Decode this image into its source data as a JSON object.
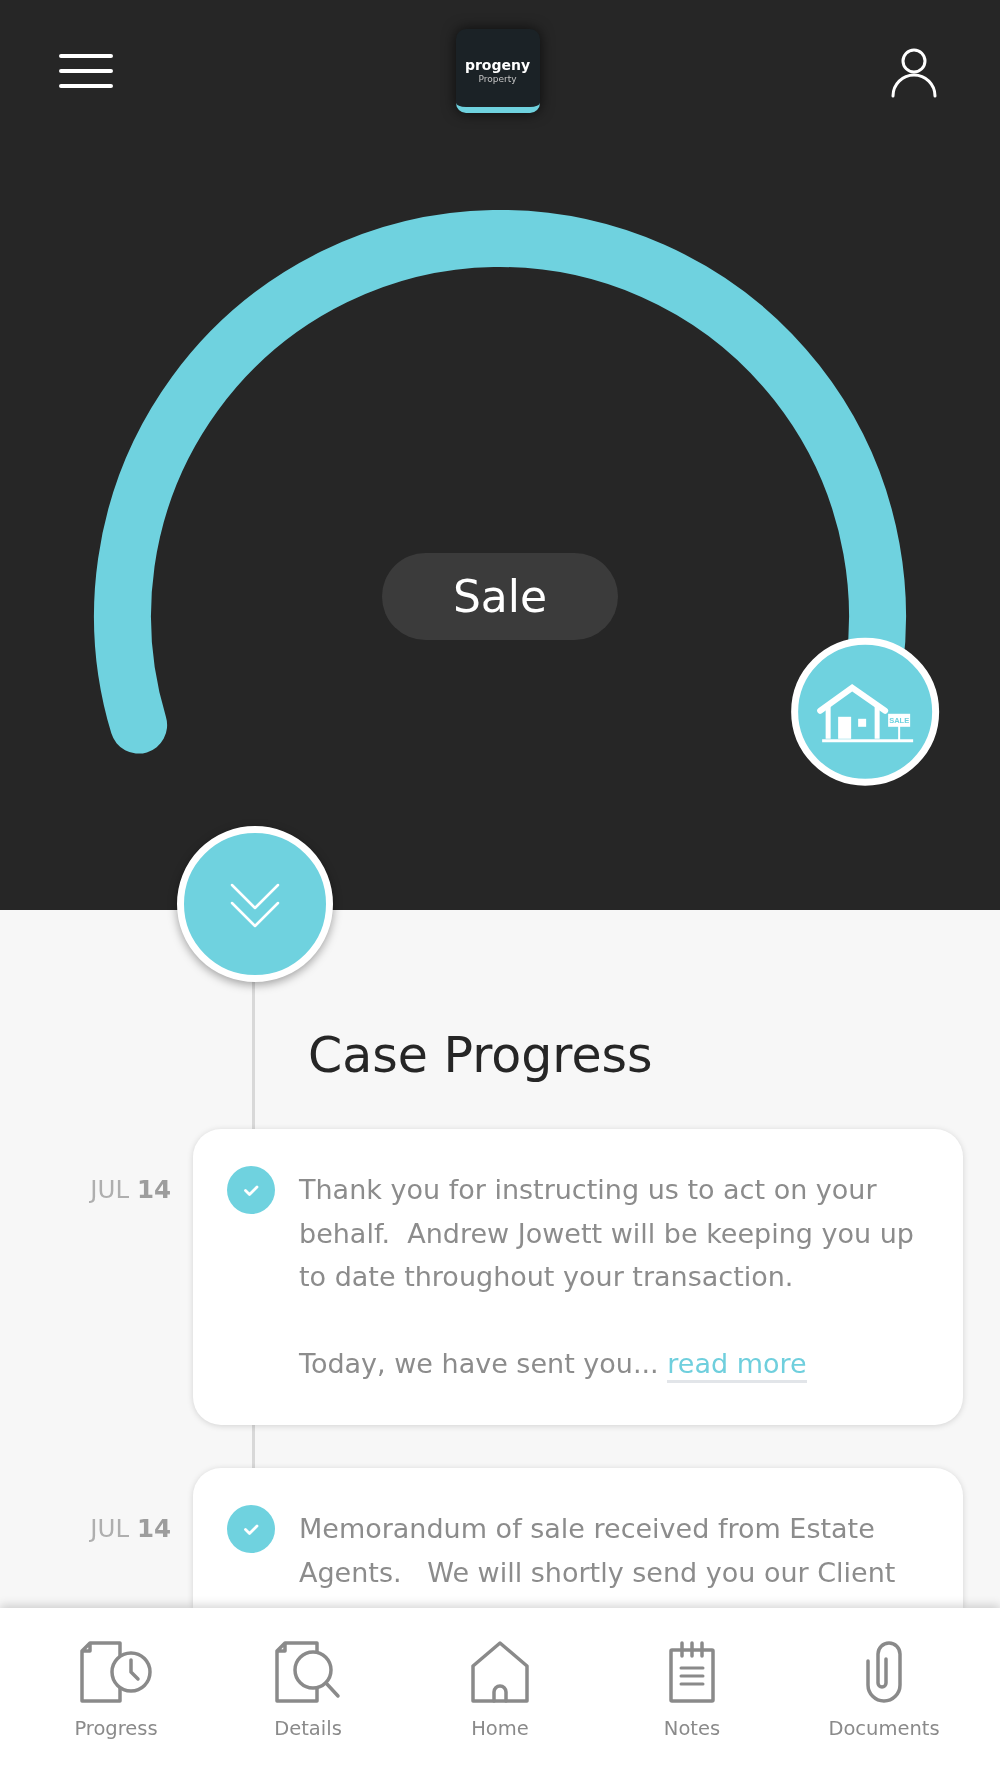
{
  "header": {
    "logo": {
      "name": "progeny",
      "tagline": "Property"
    }
  },
  "gauge": {
    "label": "Sale",
    "sign": "SALE"
  },
  "timeline": {
    "title": "Case Progress",
    "entries": [
      {
        "date": "JUL **14**",
        "done": true,
        "paragraphs": [
          "Thank you for instructing us to act on your behalf.  Andrew Jowett will be keeping you up to date throughout your transaction.",
          "Today, we have sent you..."
        ],
        "link": "read more"
      },
      {
        "date": "JUL **14**",
        "done": true,
        "paragraphs": [
          "Memorandum of sale received from Estate Agents.   We will shortly send you our Client"
        ]
      }
    ]
  },
  "tab_bar": [
    {
      "label": "Progress",
      "kind": "progress"
    },
    {
      "label": "Details",
      "kind": "details"
    },
    {
      "label": "Home",
      "kind": "home"
    },
    {
      "label": "Notes",
      "kind": "notes"
    },
    {
      "label": "Documents",
      "kind": "documents"
    }
  ]
}
